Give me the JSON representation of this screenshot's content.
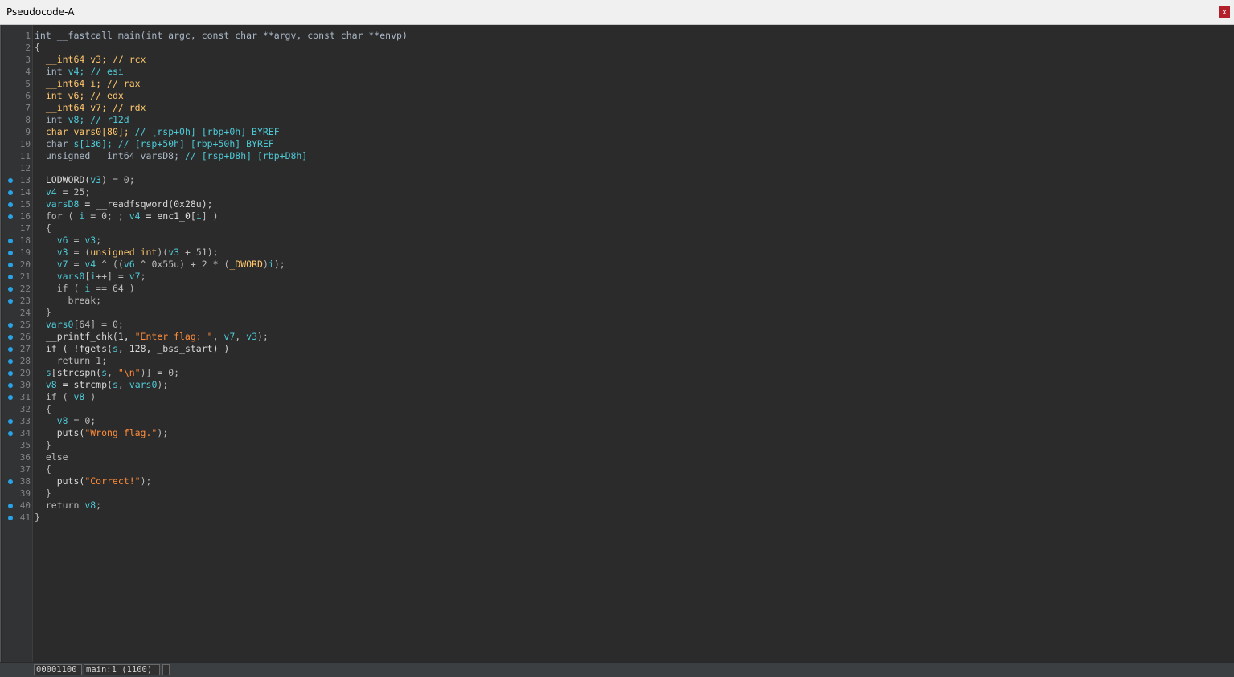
{
  "window": {
    "title": "Pseudocode-A",
    "close_label": "x"
  },
  "status": {
    "address": "00001100",
    "location": "main:1 (1100)",
    "extra": ""
  },
  "lines": [
    {
      "n": "1",
      "bp": false,
      "tokens": [
        [
          "int __fastcall main(int argc, const char **argv, const char **envp)",
          "kw"
        ]
      ]
    },
    {
      "n": "2",
      "bp": false,
      "tokens": [
        [
          "{",
          "plain"
        ]
      ]
    },
    {
      "n": "3",
      "bp": false,
      "tokens": [
        [
          "  ",
          "plain"
        ],
        [
          "__int64 v3; // rcx",
          "type"
        ]
      ]
    },
    {
      "n": "4",
      "bp": false,
      "tokens": [
        [
          "  ",
          "plain"
        ],
        [
          "int ",
          "kw"
        ],
        [
          "v4; // esi",
          "var"
        ]
      ]
    },
    {
      "n": "5",
      "bp": false,
      "tokens": [
        [
          "  ",
          "plain"
        ],
        [
          "__int64 i; // rax",
          "type"
        ]
      ]
    },
    {
      "n": "6",
      "bp": false,
      "tokens": [
        [
          "  ",
          "plain"
        ],
        [
          "int v6; // edx",
          "type"
        ]
      ]
    },
    {
      "n": "7",
      "bp": false,
      "tokens": [
        [
          "  ",
          "plain"
        ],
        [
          "__int64 v7; // rdx",
          "type"
        ]
      ]
    },
    {
      "n": "8",
      "bp": false,
      "tokens": [
        [
          "  ",
          "plain"
        ],
        [
          "int ",
          "kw"
        ],
        [
          "v8; // r12d",
          "var"
        ]
      ]
    },
    {
      "n": "9",
      "bp": false,
      "tokens": [
        [
          "  ",
          "plain"
        ],
        [
          "char vars0[80]; ",
          "type"
        ],
        [
          "// [rsp+0h] [rbp+0h] BYREF",
          "cm"
        ]
      ]
    },
    {
      "n": "10",
      "bp": false,
      "tokens": [
        [
          "  ",
          "plain"
        ],
        [
          "char ",
          "kw"
        ],
        [
          "s[136]; // [rsp+50h] [rbp+50h] BYREF",
          "var"
        ]
      ]
    },
    {
      "n": "11",
      "bp": false,
      "tokens": [
        [
          "  ",
          "plain"
        ],
        [
          "unsigned __int64 varsD8; ",
          "kw"
        ],
        [
          "// [rsp+D8h] [rbp+D8h]",
          "cm"
        ]
      ]
    },
    {
      "n": "12",
      "bp": false,
      "tokens": [
        [
          "",
          "plain"
        ]
      ]
    },
    {
      "n": "13",
      "bp": true,
      "tokens": [
        [
          "  LODWORD(",
          "fn"
        ],
        [
          "v3",
          "var"
        ],
        [
          ") = 0;",
          "plain"
        ]
      ]
    },
    {
      "n": "14",
      "bp": true,
      "tokens": [
        [
          "  ",
          "plain"
        ],
        [
          "v4",
          "var"
        ],
        [
          " = 25;",
          "plain"
        ]
      ]
    },
    {
      "n": "15",
      "bp": true,
      "tokens": [
        [
          "  ",
          "plain"
        ],
        [
          "varsD8",
          "var"
        ],
        [
          " = __readfsqword(0x28u);",
          "fn"
        ]
      ]
    },
    {
      "n": "16",
      "bp": true,
      "tokens": [
        [
          "  for ( ",
          "plain"
        ],
        [
          "i",
          "var"
        ],
        [
          " = 0; ; ",
          "plain"
        ],
        [
          "v4",
          "var"
        ],
        [
          " = enc1_0[",
          "fn"
        ],
        [
          "i",
          "var"
        ],
        [
          "] )",
          "plain"
        ]
      ]
    },
    {
      "n": "17",
      "bp": false,
      "tokens": [
        [
          "  {",
          "plain"
        ]
      ]
    },
    {
      "n": "18",
      "bp": true,
      "tokens": [
        [
          "    ",
          "plain"
        ],
        [
          "v6",
          "var"
        ],
        [
          " = ",
          "plain"
        ],
        [
          "v3",
          "var"
        ],
        [
          ";",
          "plain"
        ]
      ]
    },
    {
      "n": "19",
      "bp": true,
      "tokens": [
        [
          "    ",
          "plain"
        ],
        [
          "v3",
          "var"
        ],
        [
          " = (",
          "plain"
        ],
        [
          "unsigned int",
          "type"
        ],
        [
          ")(",
          "plain"
        ],
        [
          "v3",
          "var"
        ],
        [
          " + 51);",
          "plain"
        ]
      ]
    },
    {
      "n": "20",
      "bp": true,
      "tokens": [
        [
          "    ",
          "plain"
        ],
        [
          "v7",
          "var"
        ],
        [
          " = ",
          "plain"
        ],
        [
          "v4",
          "var"
        ],
        [
          " ^ ((",
          "plain"
        ],
        [
          "v6",
          "var"
        ],
        [
          " ^ 0x55u) + 2 * (",
          "plain"
        ],
        [
          "_DWORD",
          "type"
        ],
        [
          ")",
          "plain"
        ],
        [
          "i",
          "var"
        ],
        [
          ");",
          "plain"
        ]
      ]
    },
    {
      "n": "21",
      "bp": true,
      "tokens": [
        [
          "    ",
          "plain"
        ],
        [
          "vars0",
          "var"
        ],
        [
          "[",
          "plain"
        ],
        [
          "i",
          "var"
        ],
        [
          "++] = ",
          "plain"
        ],
        [
          "v7",
          "var"
        ],
        [
          ";",
          "plain"
        ]
      ]
    },
    {
      "n": "22",
      "bp": true,
      "tokens": [
        [
          "    if ( ",
          "plain"
        ],
        [
          "i",
          "var"
        ],
        [
          " == 64 )",
          "plain"
        ]
      ]
    },
    {
      "n": "23",
      "bp": true,
      "tokens": [
        [
          "      break;",
          "plain"
        ]
      ]
    },
    {
      "n": "24",
      "bp": false,
      "tokens": [
        [
          "  }",
          "plain"
        ]
      ]
    },
    {
      "n": "25",
      "bp": true,
      "tokens": [
        [
          "  ",
          "plain"
        ],
        [
          "vars0",
          "var"
        ],
        [
          "[64] = 0;",
          "plain"
        ]
      ]
    },
    {
      "n": "26",
      "bp": true,
      "tokens": [
        [
          "  __printf_chk(1, ",
          "fn"
        ],
        [
          "\"Enter flag: \"",
          "str"
        ],
        [
          ", ",
          "plain"
        ],
        [
          "v7",
          "var"
        ],
        [
          ", ",
          "plain"
        ],
        [
          "v3",
          "var"
        ],
        [
          ");",
          "plain"
        ]
      ]
    },
    {
      "n": "27",
      "bp": true,
      "tokens": [
        [
          "  if ( !fgets(",
          "fn"
        ],
        [
          "s",
          "var"
        ],
        [
          ", 128, _bss_start) )",
          "fn"
        ]
      ]
    },
    {
      "n": "28",
      "bp": true,
      "tokens": [
        [
          "    return 1;",
          "plain"
        ]
      ]
    },
    {
      "n": "29",
      "bp": true,
      "tokens": [
        [
          "  ",
          "plain"
        ],
        [
          "s",
          "var"
        ],
        [
          "[strcspn(",
          "fn"
        ],
        [
          "s",
          "var"
        ],
        [
          ", ",
          "plain"
        ],
        [
          "\"\\n\"",
          "str"
        ],
        [
          ")] = 0;",
          "plain"
        ]
      ]
    },
    {
      "n": "30",
      "bp": true,
      "tokens": [
        [
          "  ",
          "plain"
        ],
        [
          "v8",
          "var"
        ],
        [
          " = strcmp(",
          "fn"
        ],
        [
          "s",
          "var"
        ],
        [
          ", ",
          "plain"
        ],
        [
          "vars0",
          "var"
        ],
        [
          ");",
          "plain"
        ]
      ]
    },
    {
      "n": "31",
      "bp": true,
      "tokens": [
        [
          "  if ( ",
          "plain"
        ],
        [
          "v8",
          "var"
        ],
        [
          " )",
          "plain"
        ]
      ]
    },
    {
      "n": "32",
      "bp": false,
      "tokens": [
        [
          "  {",
          "plain"
        ]
      ]
    },
    {
      "n": "33",
      "bp": true,
      "tokens": [
        [
          "    ",
          "plain"
        ],
        [
          "v8",
          "var"
        ],
        [
          " = 0;",
          "plain"
        ]
      ]
    },
    {
      "n": "34",
      "bp": true,
      "tokens": [
        [
          "    puts(",
          "fn"
        ],
        [
          "\"Wrong flag.\"",
          "str"
        ],
        [
          ");",
          "plain"
        ]
      ]
    },
    {
      "n": "35",
      "bp": false,
      "tokens": [
        [
          "  }",
          "plain"
        ]
      ]
    },
    {
      "n": "36",
      "bp": false,
      "tokens": [
        [
          "  else",
          "plain"
        ]
      ]
    },
    {
      "n": "37",
      "bp": false,
      "tokens": [
        [
          "  {",
          "plain"
        ]
      ]
    },
    {
      "n": "38",
      "bp": true,
      "tokens": [
        [
          "    puts(",
          "fn"
        ],
        [
          "\"Correct!\"",
          "str"
        ],
        [
          ");",
          "plain"
        ]
      ]
    },
    {
      "n": "39",
      "bp": false,
      "tokens": [
        [
          "  }",
          "plain"
        ]
      ]
    },
    {
      "n": "40",
      "bp": true,
      "tokens": [
        [
          "  return ",
          "plain"
        ],
        [
          "v8",
          "var"
        ],
        [
          ";",
          "plain"
        ]
      ]
    },
    {
      "n": "41",
      "bp": true,
      "tokens": [
        [
          "}",
          "plain"
        ]
      ]
    }
  ]
}
